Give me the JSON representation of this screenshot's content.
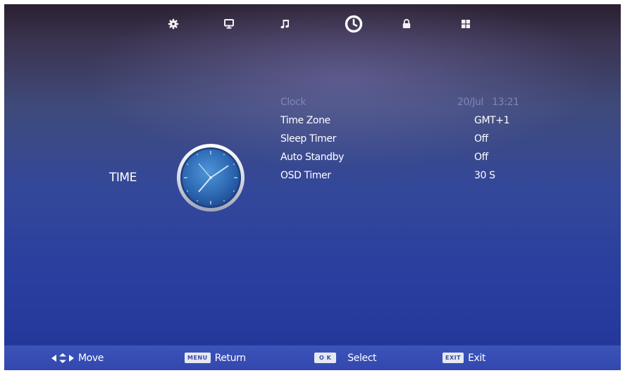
{
  "tabs": [
    {
      "id": "picture",
      "icon": "gear-icon",
      "active": false
    },
    {
      "id": "screen",
      "icon": "monitor-icon",
      "active": false
    },
    {
      "id": "sound",
      "icon": "music-note-icon",
      "active": false
    },
    {
      "id": "time",
      "icon": "clock-icon",
      "active": true
    },
    {
      "id": "lock",
      "icon": "lock-icon",
      "active": false
    },
    {
      "id": "setup",
      "icon": "grid-icon",
      "active": false
    }
  ],
  "section": {
    "title": "TIME",
    "icon": "analog-clock-icon"
  },
  "settings": [
    {
      "label": "Clock",
      "value": "20/Jul   13:21",
      "disabled": true
    },
    {
      "label": "Time Zone",
      "value": "GMT+1",
      "disabled": false
    },
    {
      "label": "Sleep Timer",
      "value": "Off",
      "disabled": false
    },
    {
      "label": "Auto Standby",
      "value": "Off",
      "disabled": false
    },
    {
      "label": "OSD Timer",
      "value": "30 S",
      "disabled": false
    }
  ],
  "hints": {
    "move": {
      "icon": "arrows-icon",
      "label": "Move"
    },
    "return": {
      "key": "MENU",
      "label": "Return"
    },
    "select": {
      "key": "O K",
      "label": "Select"
    },
    "exit": {
      "key": "EXIT",
      "label": "Exit"
    }
  },
  "colors": {
    "background_top": "#2a2030",
    "background_bottom": "#22369a",
    "hint_bar": "#3c53b8",
    "disabled_text": "#7f86b8",
    "text": "#ffffff"
  }
}
